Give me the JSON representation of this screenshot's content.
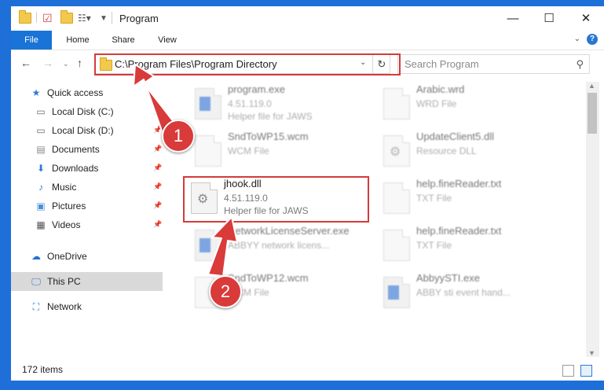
{
  "title": "Program",
  "ribbon": {
    "tabs": [
      "File",
      "Home",
      "Share",
      "View"
    ]
  },
  "address": {
    "path": "C:\\Program Files\\Program Directory"
  },
  "search": {
    "placeholder": "Search Program"
  },
  "sidebar": {
    "items": [
      {
        "label": "Quick access",
        "icon": "star-icon"
      },
      {
        "label": "Local Disk (C:)",
        "icon": "drive-icon",
        "pinned": true
      },
      {
        "label": "Local Disk (D:)",
        "icon": "drive-icon",
        "pinned": true
      },
      {
        "label": "Documents",
        "icon": "documents-icon",
        "pinned": true
      },
      {
        "label": "Downloads",
        "icon": "download-icon",
        "pinned": true
      },
      {
        "label": "Music",
        "icon": "music-icon",
        "pinned": true
      },
      {
        "label": "Pictures",
        "icon": "pictures-icon",
        "pinned": true
      },
      {
        "label": "Videos",
        "icon": "videos-icon",
        "pinned": true
      },
      {
        "label": "OneDrive",
        "icon": "cloud-icon"
      },
      {
        "label": "This PC",
        "icon": "computer-icon",
        "selected": true
      },
      {
        "label": "Network",
        "icon": "network-icon"
      }
    ]
  },
  "files": [
    {
      "name": "program.exe",
      "line1": "4.51.119.0",
      "line2": "Helper file for JAWS",
      "icon": "app"
    },
    {
      "name": "Arabic.wrd",
      "line1": "WRD File",
      "line2": "",
      "icon": "blank"
    },
    {
      "name": "SndToWP15.wcm",
      "line1": "WCM File",
      "line2": "",
      "icon": "blank"
    },
    {
      "name": "UpdateClient5.dll",
      "line1": "Resource DLL",
      "line2": "",
      "icon": "gear"
    },
    {
      "name": "jhook.dll",
      "line1": "4.51.119.0",
      "line2": "Helper file for JAWS",
      "icon": "gear"
    },
    {
      "name": "help.fineReader.txt",
      "line1": "TXT File",
      "line2": "",
      "icon": "blank"
    },
    {
      "name": "NetworkLicenseServer.exe",
      "line1": "ABBYY network licens...",
      "line2": "",
      "icon": "app"
    },
    {
      "name": "help.fineReader.txt",
      "line1": "TXT File",
      "line2": "",
      "icon": "blank"
    },
    {
      "name": "SndToWP12.wcm",
      "line1": "WCM File",
      "line2": "",
      "icon": "blank"
    },
    {
      "name": "AbbyySTI.exe",
      "line1": "ABBY sti event hand...",
      "line2": "",
      "icon": "app"
    }
  ],
  "status": {
    "items_count": "172 items"
  },
  "annotations": {
    "step1": "1",
    "step2": "2"
  },
  "colors": {
    "accent": "#1a73d6",
    "highlight": "#d33b3b",
    "desktop": "#1e6fd8"
  }
}
